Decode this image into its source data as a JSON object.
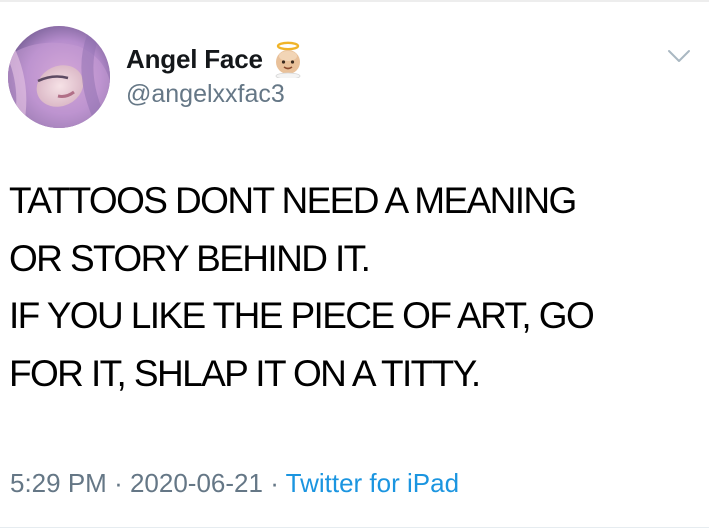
{
  "author": {
    "display_name": "Angel Face",
    "handle": "@angelxxfac3",
    "badge_icon": "baby-angel-emoji"
  },
  "tweet": {
    "lines": [
      "TATTOOS DONT NEED A MEANING",
      "OR STORY BEHIND IT.",
      "IF YOU LIKE THE PIECE OF ART, GO",
      "FOR IT, SHLAP IT ON A TITTY."
    ]
  },
  "meta": {
    "time": "5:29 PM",
    "separator": "·",
    "date": "2020-06-21",
    "source": "Twitter for iPad"
  },
  "icons": {
    "menu": "chevron-down-icon"
  },
  "colors": {
    "secondary_text": "#657786",
    "link": "#1b95e0",
    "text": "#000000"
  }
}
